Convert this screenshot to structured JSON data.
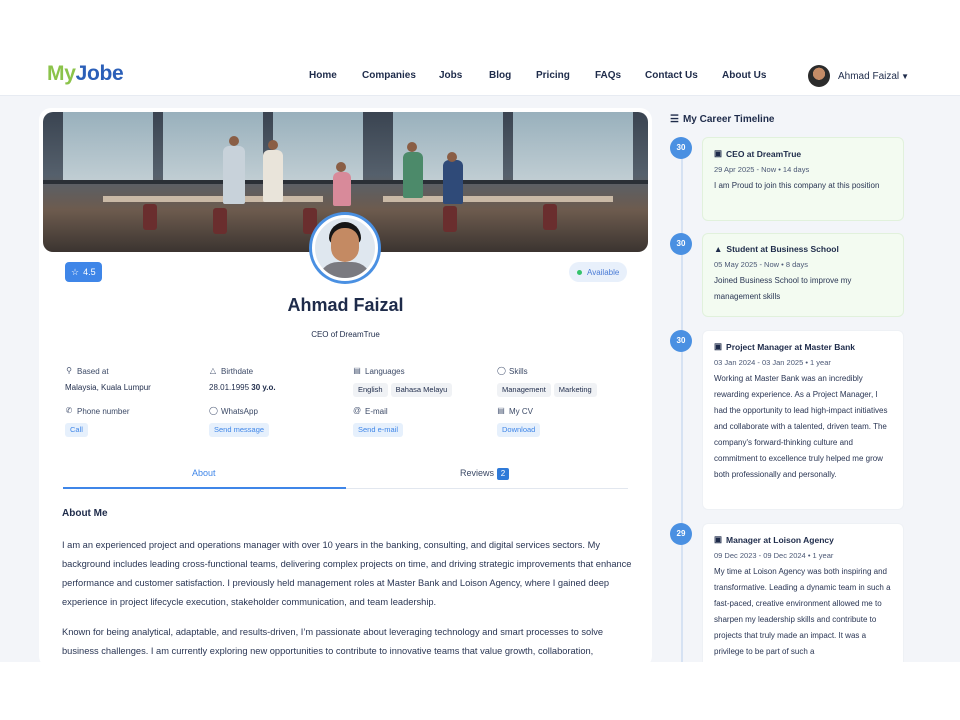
{
  "header": {
    "logo_my": "My",
    "logo_jobe": "Jobe",
    "nav": [
      "Home",
      "Companies",
      "Jobs",
      "Blog",
      "Pricing",
      "FAQs",
      "Contact Us",
      "About Us"
    ],
    "user_name": "Ahmad Faizal"
  },
  "profile": {
    "rating": "4.5",
    "status": "Available",
    "name": "Ahmad Faizal",
    "title": "CEO of DreamTrue",
    "info": {
      "based_label": "Based at",
      "based_value": "Malaysia, Kuala Lumpur",
      "birth_label": "Birthdate",
      "birth_value": "28.01.1995",
      "birth_age": "30 y.o.",
      "lang_label": "Languages",
      "languages": [
        "English",
        "Bahasa Melayu"
      ],
      "skills_label": "Skills",
      "skills": [
        "Management",
        "Marketing"
      ],
      "phone_label": "Phone number",
      "phone_action": "Call",
      "whatsapp_label": "WhatsApp",
      "whatsapp_action": "Send message",
      "email_label": "E-mail",
      "email_action": "Send e-mail",
      "cv_label": "My CV",
      "cv_action": "Download"
    },
    "tabs": {
      "about": "About",
      "reviews": "Reviews",
      "reviews_count": "2"
    },
    "about_heading": "About Me",
    "about_p1": "I am an experienced project and operations manager with over 10 years in the banking, consulting, and digital services sectors. My background includes leading cross-functional teams, delivering complex projects on time, and driving strategic improvements that enhance performance and customer satisfaction. I previously held management roles at Master Bank and Loison Agency, where I gained deep experience in project lifecycle execution, stakeholder communication, and team leadership.",
    "about_p2": "Known for being analytical, adaptable, and results-driven, I’m passionate about leveraging technology and smart processes to solve business challenges. I am currently exploring new opportunities to contribute to innovative teams that value growth, collaboration,"
  },
  "timeline": {
    "title": "My Career Timeline",
    "items": [
      {
        "day": "30",
        "title": "CEO at DreamTrue",
        "dates": "29 Apr 2025 - Now",
        "duration": "14 days",
        "text": "I am Proud to join this company at this position",
        "icon": "briefcase-icon"
      },
      {
        "day": "30",
        "title": "Student at Business School",
        "dates": "05 May 2025 - Now",
        "duration": "8 days",
        "text": "Joined Business School to improve my management skills",
        "icon": "graduation-cap-icon"
      },
      {
        "day": "30",
        "title": "Project Manager at Master Bank",
        "dates": "03 Jan 2024 - 03 Jan 2025",
        "duration": "1 year",
        "text": "Working at Master Bank was an incredibly rewarding experience. As a Project Manager, I had the opportunity to lead high-impact initiatives and collaborate with a talented, driven team. The company's forward-thinking culture and commitment to excellence truly helped me grow both professionally and personally.",
        "icon": "briefcase-icon"
      },
      {
        "day": "29",
        "title": "Manager at Loison Agency",
        "dates": "09 Dec 2023 - 09 Dec 2024",
        "duration": "1 year",
        "text": "My time at Loison Agency was both inspiring and transformative. Leading a dynamic team in such a fast-paced, creative environment allowed me to sharpen my leadership skills and contribute to projects that truly made an impact. It was a privilege to be part of such a",
        "icon": "briefcase-icon"
      }
    ]
  },
  "colors": {
    "accent": "#3f86e8",
    "logo_green": "#8bc34a",
    "logo_blue": "#2b5fb8",
    "text": "#1e2b4a",
    "status_green": "#34c36b"
  }
}
